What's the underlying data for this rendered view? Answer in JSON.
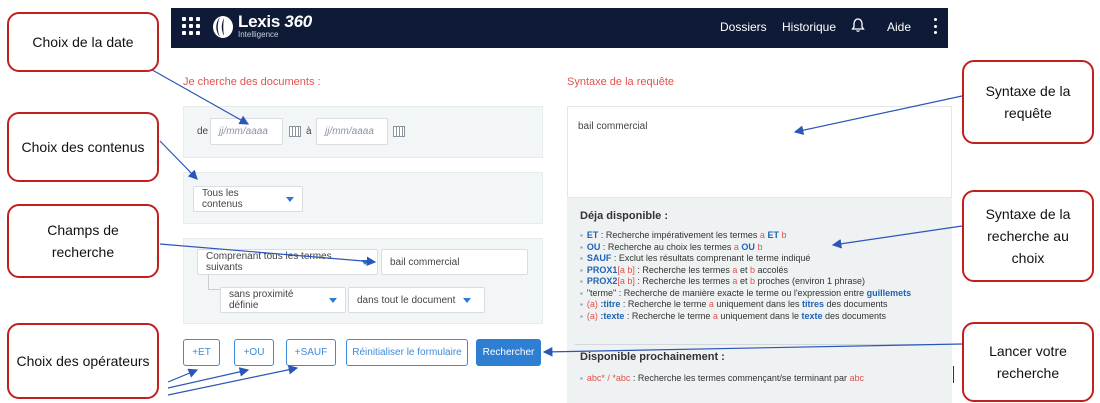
{
  "topbar": {
    "brand": "Lexis",
    "brand_num": "360",
    "brand_sub": "Intelligence",
    "nav": [
      "Dossiers",
      "Historique",
      "Aide"
    ],
    "icons": [
      "apps-grid-icon",
      "lexis-logo-icon",
      "bell-icon",
      "more-vertical-icon"
    ],
    "bg_color": "#0e1a36"
  },
  "left": {
    "heading": "Je cherche des documents :",
    "date": {
      "from_label": "de",
      "from_placeholder": "jj/mm/aaaa",
      "to_label": "à",
      "to_placeholder": "jj/mm/aaaa"
    },
    "contents_select": "Tous les contenus",
    "terms_select": "Comprenant tous les termes suivants",
    "search_value": "bail commercial",
    "proximity_select": "sans proximité définie",
    "scope_select": "dans tout le document",
    "operators": [
      "+ET",
      "+OU",
      "+SAUF"
    ],
    "reset_button": "Réinitialiser le formulaire",
    "search_button": "Rechercher"
  },
  "right": {
    "heading": "Syntaxe de la requête",
    "query_text": "bail commercial",
    "available_heading": "Déja disponible :",
    "syntax_items": [
      {
        "k": "ET",
        "pre": "",
        "text": " : Recherche impérativement les termes "
      },
      {
        "k": "OU",
        "pre": "",
        "text": " : Recherche au choix les termes "
      },
      {
        "k": "SAUF",
        "pre": "",
        "text": " : Exclut les résultats comprenant le terme indiqué"
      },
      {
        "k": "PROX1",
        "pre": "",
        "text": " : Recherche les termes "
      },
      {
        "k": "PROX2",
        "pre": "",
        "text": " : Recherche les termes "
      },
      {
        "k": "",
        "pre": "\"terme\"",
        "text": " : Recherche de manière exacte le terme ou l'expression entre "
      },
      {
        "k": ":titre",
        "pre": "(a) ",
        "text": " : Recherche le terme "
      },
      {
        "k": ":texte",
        "pre": "(a) ",
        "text": " : Recherche le terme "
      }
    ],
    "syntax_tails": {
      "et_a": "a",
      "et_mid": " ET ",
      "et_b": "b",
      "ou_a": "a",
      "ou_mid": " OU ",
      "ou_b": "b",
      "prox1_args": "[a b]",
      "prox1_a": "a",
      "prox1_et": " et ",
      "prox1_b": "b",
      "prox1_end": " accolés",
      "prox2_args": "[a b]",
      "prox2_a": "a",
      "prox2_et": " et ",
      "prox2_b": "b",
      "prox2_end": " proches (environ 1 phrase)",
      "guillemets": "guillemets",
      "titre_a": "a",
      "titre_mid": " uniquement dans les ",
      "titre_kw": "titres",
      "titre_end": " des documents",
      "texte_a": "a",
      "texte_mid": " uniquement dans le ",
      "texte_kw": "texte",
      "texte_end": " des documents"
    },
    "upcoming_heading": "Disponible prochainement :",
    "upcoming_item_kw": "abc* / *abc",
    "upcoming_item_text": " : Recherche les termes commençant/se terminant par ",
    "upcoming_item_end": "abc"
  },
  "callouts": {
    "date": "Choix de la date",
    "contents": "Choix des contenus",
    "fields": "Champs de recherche",
    "operators": "Choix des opérateurs",
    "query_syntax": "Syntaxe de la requête",
    "syntax_choice": "Syntaxe de la recherche au choix",
    "launch": "Lancer votre recherche"
  },
  "colors": {
    "accent": "#2e7ed1",
    "heading_red": "#e2534d",
    "callout_border": "#c0201e"
  }
}
